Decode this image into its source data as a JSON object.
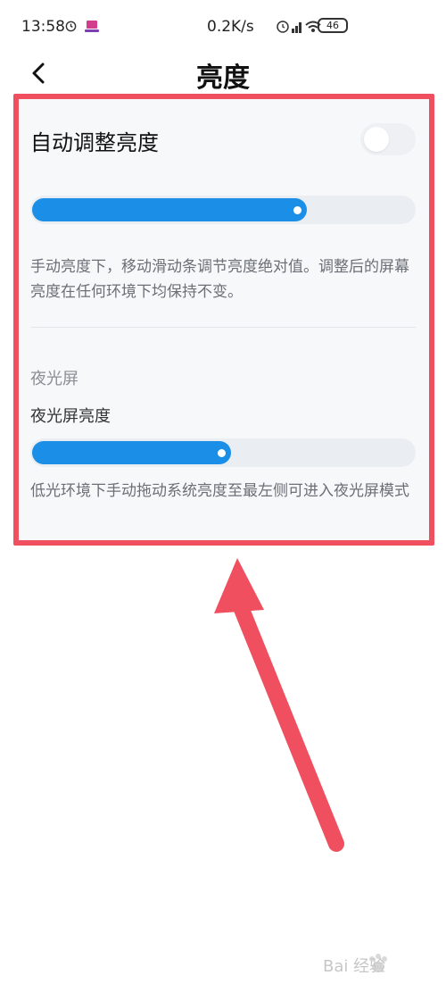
{
  "status_bar": {
    "time": "13:58",
    "network_speed": "0.2K/s",
    "battery": "46"
  },
  "header": {
    "title": "亮度"
  },
  "brightness": {
    "auto_label": "自动调整亮度",
    "auto_enabled": false,
    "slider_level": 0.72,
    "description": "手动亮度下，移动滑动条调节亮度绝对值。调整后的屏幕亮度在任何环境下均保持不变。"
  },
  "night_screen": {
    "section_title": "夜光屏",
    "label": "夜光屏亮度",
    "slider_level": 0.52,
    "description": "低光环境下手动拖动系统亮度至最左侧可进入夜光屏模式"
  },
  "colors": {
    "accent": "#1b8ee8",
    "highlight": "#ef4f5f",
    "arrow": "#ef4f5f"
  },
  "watermark": {
    "text": "Bai 经验"
  }
}
